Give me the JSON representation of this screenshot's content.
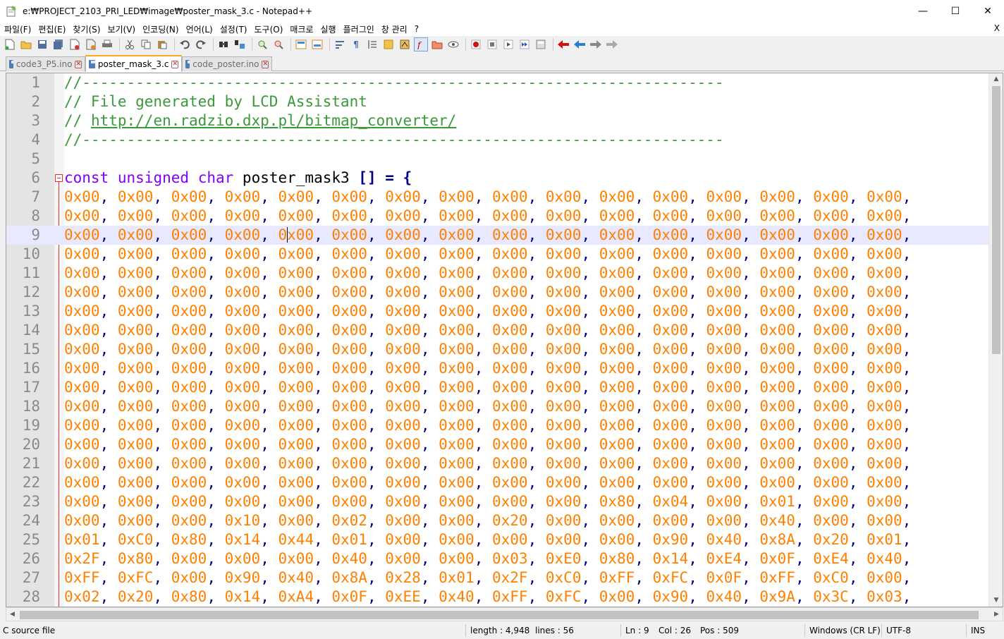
{
  "window": {
    "title": "e:₩PROJECT_2103_PRI_LED₩image₩poster_mask_3.c - Notepad++",
    "minimize": "—",
    "maximize": "☐",
    "close": "✕"
  },
  "menu": {
    "items": [
      "파일(F)",
      "편집(E)",
      "찾기(S)",
      "보기(V)",
      "인코딩(N)",
      "언어(L)",
      "설정(T)",
      "도구(O)",
      "매크로",
      "실행",
      "플러그인",
      "창 관리",
      "?"
    ],
    "close": "X"
  },
  "toolbar": {
    "icons": [
      "new-file",
      "open-file",
      "save",
      "save-all",
      "close",
      "close-all",
      "print",
      "cut",
      "copy",
      "paste",
      "undo",
      "redo",
      "find",
      "replace",
      "zoom-in",
      "zoom-out",
      "sync-v",
      "sync-h",
      "wrap",
      "all-chars",
      "indent-guide",
      "udl",
      "doc-map",
      "function-list",
      "folder-workspace",
      "monitor",
      "record",
      "stop",
      "play",
      "run-multiple",
      "save-macro"
    ],
    "colors": {
      "record": "#d01010",
      "nav": "#2a7fd4",
      "back": "#d01010"
    }
  },
  "tabs": [
    {
      "label": "code3_P5.ino",
      "active": false
    },
    {
      "label": "poster_mask_3.c",
      "active": true
    },
    {
      "label": "code_poster.ino",
      "active": false
    }
  ],
  "editor": {
    "line_numbers": [
      "1",
      "2",
      "3",
      "4",
      "5",
      "6",
      "7",
      "8",
      "9",
      "10",
      "11",
      "12",
      "13",
      "14",
      "15",
      "16",
      "17",
      "18",
      "19",
      "20",
      "21",
      "22",
      "23",
      "24",
      "25",
      "26",
      "27",
      "28"
    ],
    "comment_rule": "//------------------------------------------------------------------------",
    "comment_title": "// File generated by LCD Assistant",
    "comment_url_prefix": "// ",
    "comment_url": "http://en.radzio.dxp.pl/bitmap_converter/",
    "decl_kw1": "const",
    "decl_kw2": "unsigned",
    "decl_kw3": "char",
    "decl_name": "poster_mask3",
    "decl_tail": "[] = {",
    "current_line": 9,
    "data_rows": [
      [
        "0x00",
        "0x00",
        "0x00",
        "0x00",
        "0x00",
        "0x00",
        "0x00",
        "0x00",
        "0x00",
        "0x00",
        "0x00",
        "0x00",
        "0x00",
        "0x00",
        "0x00",
        "0x00"
      ],
      [
        "0x00",
        "0x00",
        "0x00",
        "0x00",
        "0x00",
        "0x00",
        "0x00",
        "0x00",
        "0x00",
        "0x00",
        "0x00",
        "0x00",
        "0x00",
        "0x00",
        "0x00",
        "0x00"
      ],
      [
        "0x00",
        "0x00",
        "0x00",
        "0x00",
        "0x00",
        "0x00",
        "0x00",
        "0x00",
        "0x00",
        "0x00",
        "0x00",
        "0x00",
        "0x00",
        "0x00",
        "0x00",
        "0x00"
      ],
      [
        "0x00",
        "0x00",
        "0x00",
        "0x00",
        "0x00",
        "0x00",
        "0x00",
        "0x00",
        "0x00",
        "0x00",
        "0x00",
        "0x00",
        "0x00",
        "0x00",
        "0x00",
        "0x00"
      ],
      [
        "0x00",
        "0x00",
        "0x00",
        "0x00",
        "0x00",
        "0x00",
        "0x00",
        "0x00",
        "0x00",
        "0x00",
        "0x00",
        "0x00",
        "0x00",
        "0x00",
        "0x00",
        "0x00"
      ],
      [
        "0x00",
        "0x00",
        "0x00",
        "0x00",
        "0x00",
        "0x00",
        "0x00",
        "0x00",
        "0x00",
        "0x00",
        "0x00",
        "0x00",
        "0x00",
        "0x00",
        "0x00",
        "0x00"
      ],
      [
        "0x00",
        "0x00",
        "0x00",
        "0x00",
        "0x00",
        "0x00",
        "0x00",
        "0x00",
        "0x00",
        "0x00",
        "0x00",
        "0x00",
        "0x00",
        "0x00",
        "0x00",
        "0x00"
      ],
      [
        "0x00",
        "0x00",
        "0x00",
        "0x00",
        "0x00",
        "0x00",
        "0x00",
        "0x00",
        "0x00",
        "0x00",
        "0x00",
        "0x00",
        "0x00",
        "0x00",
        "0x00",
        "0x00"
      ],
      [
        "0x00",
        "0x00",
        "0x00",
        "0x00",
        "0x00",
        "0x00",
        "0x00",
        "0x00",
        "0x00",
        "0x00",
        "0x00",
        "0x00",
        "0x00",
        "0x00",
        "0x00",
        "0x00"
      ],
      [
        "0x00",
        "0x00",
        "0x00",
        "0x00",
        "0x00",
        "0x00",
        "0x00",
        "0x00",
        "0x00",
        "0x00",
        "0x00",
        "0x00",
        "0x00",
        "0x00",
        "0x00",
        "0x00"
      ],
      [
        "0x00",
        "0x00",
        "0x00",
        "0x00",
        "0x00",
        "0x00",
        "0x00",
        "0x00",
        "0x00",
        "0x00",
        "0x00",
        "0x00",
        "0x00",
        "0x00",
        "0x00",
        "0x00"
      ],
      [
        "0x00",
        "0x00",
        "0x00",
        "0x00",
        "0x00",
        "0x00",
        "0x00",
        "0x00",
        "0x00",
        "0x00",
        "0x00",
        "0x00",
        "0x00",
        "0x00",
        "0x00",
        "0x00"
      ],
      [
        "0x00",
        "0x00",
        "0x00",
        "0x00",
        "0x00",
        "0x00",
        "0x00",
        "0x00",
        "0x00",
        "0x00",
        "0x00",
        "0x00",
        "0x00",
        "0x00",
        "0x00",
        "0x00"
      ],
      [
        "0x00",
        "0x00",
        "0x00",
        "0x00",
        "0x00",
        "0x00",
        "0x00",
        "0x00",
        "0x00",
        "0x00",
        "0x00",
        "0x00",
        "0x00",
        "0x00",
        "0x00",
        "0x00"
      ],
      [
        "0x00",
        "0x00",
        "0x00",
        "0x00",
        "0x00",
        "0x00",
        "0x00",
        "0x00",
        "0x00",
        "0x00",
        "0x00",
        "0x00",
        "0x00",
        "0x00",
        "0x00",
        "0x00"
      ],
      [
        "0x00",
        "0x00",
        "0x00",
        "0x00",
        "0x00",
        "0x00",
        "0x00",
        "0x00",
        "0x00",
        "0x00",
        "0x00",
        "0x00",
        "0x00",
        "0x00",
        "0x00",
        "0x00"
      ],
      [
        "0x00",
        "0x00",
        "0x00",
        "0x00",
        "0x00",
        "0x00",
        "0x00",
        "0x00",
        "0x00",
        "0x00",
        "0x80",
        "0x04",
        "0x00",
        "0x01",
        "0x00",
        "0x00"
      ],
      [
        "0x00",
        "0x00",
        "0x00",
        "0x10",
        "0x00",
        "0x02",
        "0x00",
        "0x00",
        "0x20",
        "0x00",
        "0x00",
        "0x00",
        "0x00",
        "0x40",
        "0x00",
        "0x00"
      ],
      [
        "0x01",
        "0xC0",
        "0x80",
        "0x14",
        "0x44",
        "0x01",
        "0x00",
        "0x00",
        "0x00",
        "0x00",
        "0x00",
        "0x90",
        "0x40",
        "0x8A",
        "0x20",
        "0x01"
      ],
      [
        "0x2F",
        "0x80",
        "0x00",
        "0x00",
        "0x00",
        "0x40",
        "0x00",
        "0x00",
        "0x03",
        "0xE0",
        "0x80",
        "0x14",
        "0xE4",
        "0x0F",
        "0xE4",
        "0x40"
      ],
      [
        "0xFF",
        "0xFC",
        "0x00",
        "0x90",
        "0x40",
        "0x8A",
        "0x28",
        "0x01",
        "0x2F",
        "0xC0",
        "0xFF",
        "0xFC",
        "0x0F",
        "0xFF",
        "0xC0",
        "0x00"
      ],
      [
        "0x02",
        "0x20",
        "0x80",
        "0x14",
        "0xA4",
        "0x0F",
        "0xEE",
        "0x40",
        "0xFF",
        "0xFC",
        "0x00",
        "0x90",
        "0x40",
        "0x9A",
        "0x3C",
        "0x03"
      ]
    ]
  },
  "status": {
    "file_type": "C source file",
    "length": "length : 4,948",
    "lines": "lines : 56",
    "ln": "Ln : 9",
    "col": "Col : 26",
    "pos": "Pos : 509",
    "eol": "Windows (CR LF)",
    "encoding": "UTF-8",
    "mode": "INS"
  }
}
